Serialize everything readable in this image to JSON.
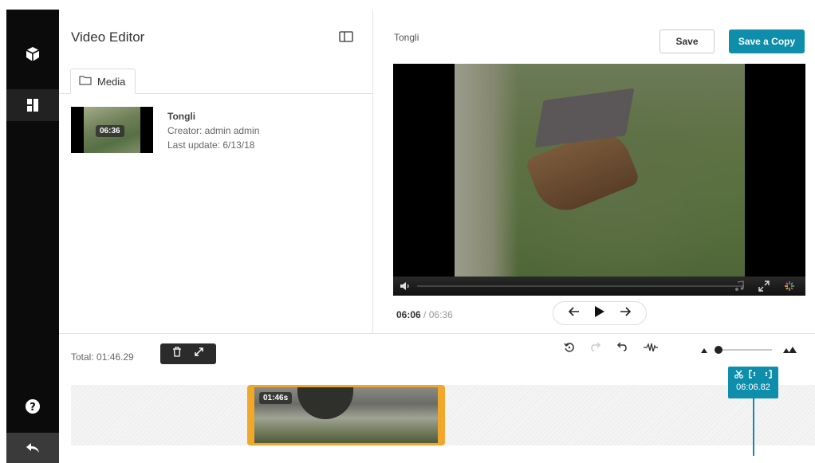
{
  "app": {
    "title": "Video Editor"
  },
  "media_tab": {
    "label": "Media"
  },
  "media_item": {
    "duration": "06:36",
    "name": "Tongli",
    "creator": "Creator: admin admin",
    "last_update": "Last update: 6/13/18"
  },
  "editor": {
    "entry_name": "Tongli",
    "save_label": "Save",
    "save_copy_label": "Save a Copy",
    "accent_color": "#0e8eab"
  },
  "player": {
    "current_time": "06:06",
    "separator": "/",
    "total_time": "06:36"
  },
  "timeline": {
    "total_label": "Total: 01:46.29",
    "clip_duration": "01:46s",
    "clip_color": "#f0a72a",
    "playhead_time": "06:06.82"
  }
}
